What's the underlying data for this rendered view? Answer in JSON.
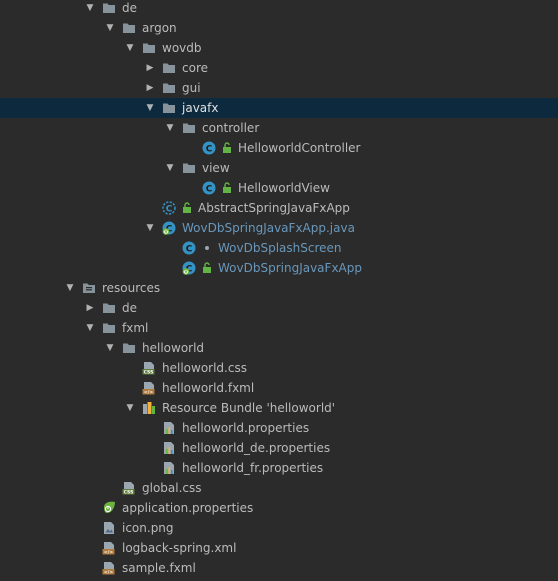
{
  "project_tree": {
    "nodes": [
      {
        "label": "de",
        "icon": "folder-icon",
        "expanded": true
      },
      {
        "label": "argon",
        "icon": "folder-icon",
        "expanded": true
      },
      {
        "label": "wovdb",
        "icon": "folder-icon",
        "expanded": true
      },
      {
        "label": "core",
        "icon": "folder-icon",
        "expanded": false
      },
      {
        "label": "gui",
        "icon": "folder-icon",
        "expanded": false
      },
      {
        "label": "javafx",
        "icon": "folder-icon",
        "expanded": true,
        "selected": true
      },
      {
        "label": "controller",
        "icon": "folder-icon",
        "expanded": true
      },
      {
        "label": "HelloworldController",
        "icon": "java-class-icon"
      },
      {
        "label": "view",
        "icon": "folder-icon",
        "expanded": true
      },
      {
        "label": "HelloworldView",
        "icon": "java-class-icon"
      },
      {
        "label": "AbstractSpringJavaFxApp",
        "icon": "abstract-class-icon"
      },
      {
        "label": "WovDbSpringJavaFxApp.java",
        "icon": "spring-boot-class-icon",
        "expanded": true
      },
      {
        "label": "WovDbSplashScreen",
        "icon": "java-class-icon"
      },
      {
        "label": "WovDbSpringJavaFxApp",
        "icon": "spring-boot-class-icon"
      },
      {
        "label": "resources",
        "icon": "resources-folder-icon",
        "expanded": true
      },
      {
        "label": "de",
        "icon": "folder-icon",
        "expanded": false
      },
      {
        "label": "fxml",
        "icon": "folder-icon",
        "expanded": true
      },
      {
        "label": "helloworld",
        "icon": "folder-icon",
        "expanded": true
      },
      {
        "label": "helloworld.css",
        "icon": "css-file-icon"
      },
      {
        "label": "helloworld.fxml",
        "icon": "fxml-file-icon"
      },
      {
        "label": "Resource Bundle 'helloworld'",
        "icon": "resource-bundle-icon",
        "expanded": true
      },
      {
        "label": "helloworld.properties",
        "icon": "properties-file-icon"
      },
      {
        "label": "helloworld_de.properties",
        "icon": "properties-file-icon"
      },
      {
        "label": "helloworld_fr.properties",
        "icon": "properties-file-icon"
      },
      {
        "label": "global.css",
        "icon": "css-file-icon"
      },
      {
        "label": "application.properties",
        "icon": "spring-properties-icon"
      },
      {
        "label": "icon.png",
        "icon": "image-file-icon"
      },
      {
        "label": "logback-spring.xml",
        "icon": "xml-file-icon"
      },
      {
        "label": "sample.fxml",
        "icon": "fxml-file-icon"
      }
    ]
  },
  "colors": {
    "background": "#2b2b2b",
    "selection": "#0d293e",
    "text": "#bbbbbb",
    "modified_text": "#6897bb",
    "folder": "#87939a",
    "class_badge": "#3592c4",
    "lock": "#62b543",
    "spring": "#6db33f"
  }
}
